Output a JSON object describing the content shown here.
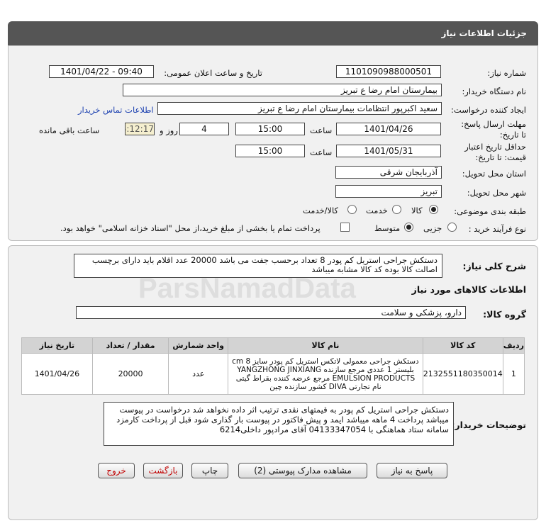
{
  "header": {
    "title": "جزئیات اطلاعات نیاز"
  },
  "form": {
    "need_number": {
      "label": "شماره نیاز:",
      "value": "1101090988000501"
    },
    "announce": {
      "label": "تاریخ و ساعت اعلان عمومی:",
      "value": "1401/04/22 - 09:40"
    },
    "buyer_org": {
      "label": "نام دستگاه خریدار:",
      "value": "بیمارستان امام رضا  ع  تبریز"
    },
    "requester": {
      "label": "ایجاد کننده درخواست:",
      "value": "سعید اکبرپور انتظامات بیمارستان امام رضا  ع  تبریز",
      "contact_link": "اطلاعات تماس خریدار"
    },
    "reply_deadline": {
      "label": "مهلت ارسال پاسخ: تا تاریخ:",
      "date": "1401/04/26",
      "time_label": "ساعت",
      "time": "15:00",
      "days": "4",
      "days_label": "روز و",
      "remaining": "05:12:17",
      "remaining_label": "ساعت باقی مانده"
    },
    "price_validity": {
      "label": "حداقل تاریخ اعتبار قیمت: تا تاریخ:",
      "date": "1401/05/31",
      "time_label": "ساعت",
      "time": "15:00"
    },
    "delivery_province": {
      "label": "استان محل تحویل:",
      "value": "آذربایجان شرقی"
    },
    "delivery_city": {
      "label": "شهر محل تحویل:",
      "value": "تبریز"
    },
    "category": {
      "label": "طبقه بندی موضوعی:",
      "options": [
        "کالا",
        "خدمت",
        "کالا/خدمت"
      ]
    },
    "process": {
      "label": "نوع فرآیند خرید :",
      "options": [
        "جزیی",
        "متوسط"
      ],
      "treasury_text": "پرداخت تمام یا بخشی از مبلغ خرید،از محل \"اسناد خزانه اسلامی\" خواهد بود."
    }
  },
  "summary": {
    "label": "شرح کلی نیاز:",
    "text": "دستکش جراحی  استریل کم پودر 8 تعداد برحسب جفت می باشد 20000 عدد اقلام باید دارای برچسب اصالت کالا بوده کد کالا مشابه میباشد"
  },
  "goods_info": {
    "title": "اطلاعات کالاهای مورد نیاز",
    "group_label": "گروه کالا:",
    "group_value": "دارو، پزشکی و سلامت"
  },
  "table": {
    "headers": [
      "ردیف",
      "کد کالا",
      "نام کالا",
      "واحد شمارش",
      "مقدار / تعداد",
      "تاریخ نیاز"
    ],
    "rows": [
      {
        "index": "1",
        "code": "2132551180350014",
        "name": "دستکش جراحی معمولی لاتکس استریل کم پودر سایز cm 8 بلیستر 1 عددی مرجع سازنده YANGZHONG JINXIANG EMULSION PRODUCTS مرجع عرضه کننده بقراط گیتی نام تجارتی DIVA کشور سازنده چین",
        "unit": "عدد",
        "qty": "20000",
        "date": "1401/04/26"
      }
    ]
  },
  "buyer_notes": {
    "label": "توضیحات خریدار:",
    "text": "دستکش جراحی  استریل کم پودر به قیمتهای نقدی ترتیب اثر داده نخواهد شد درخواست در پیوست میباشد پرداخت 4 ماهه میباشد ایمد و پیش فاکتور در پیوست بار گذاری شود قبل از پرداخت کارمزد سامانه ستاد هماهنگی با 04133347054   آقای مرادپور داخلی6214"
  },
  "buttons": {
    "reply": "پاسخ به نیاز",
    "attachments": "مشاهده مدارک پیوستی (2)",
    "print": "چاپ",
    "back": "بازگشت",
    "exit": "خروج"
  },
  "watermark": "ParsNamadData"
}
